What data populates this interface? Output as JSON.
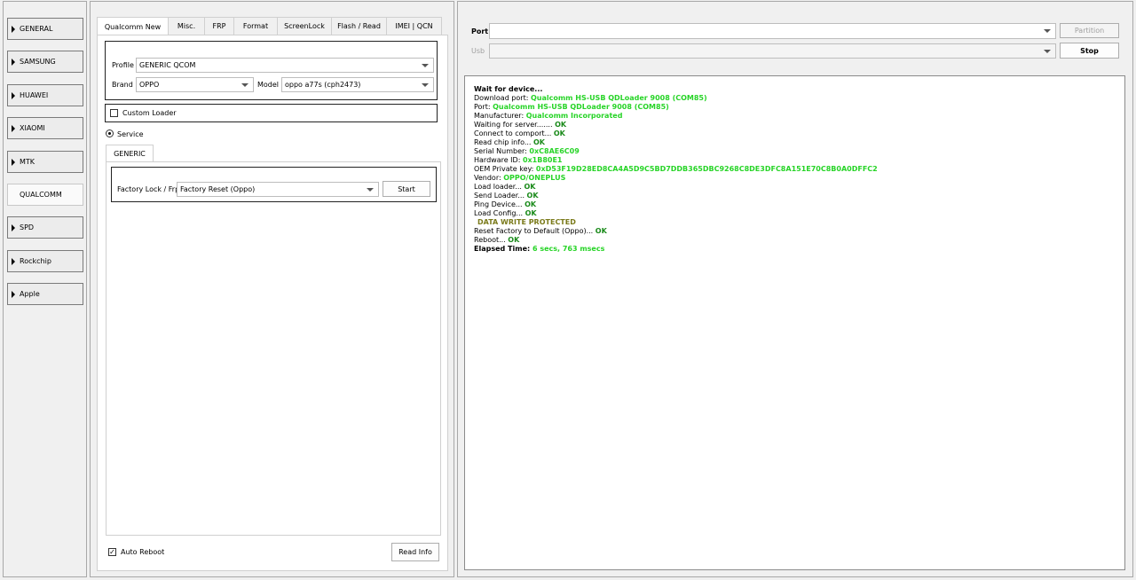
{
  "nav": {
    "items": [
      {
        "label": "GENERAL",
        "arrow": true
      },
      {
        "label": "SAMSUNG",
        "arrow": true
      },
      {
        "label": "HUAWEI",
        "arrow": true
      },
      {
        "label": "XIAOMI",
        "arrow": true
      },
      {
        "label": "MTK",
        "arrow": true
      },
      {
        "label": "QUALCOMM",
        "arrow": false,
        "active": true
      },
      {
        "label": "SPD",
        "arrow": true
      },
      {
        "label": "Rockchip",
        "arrow": true
      },
      {
        "label": "Apple",
        "arrow": true
      }
    ]
  },
  "tabs": [
    "Qualcomm New",
    "Misc.",
    "FRP",
    "Format",
    "ScreenLock",
    "Flash / Read",
    "IMEI | QCN"
  ],
  "form": {
    "profile_label": "Profile",
    "profile_value": "GENERIC QCOM",
    "brand_label": "Brand",
    "brand_value": "OPPO",
    "model_label": "Model",
    "model_value": "oppo a77s (cph2473)",
    "custom_loader_label": "Custom Loader",
    "service_label": "Service",
    "subtab_label": "GENERIC",
    "factory_label": "Factory Lock / Frp",
    "factory_value": "Factory Reset (Oppo)",
    "start_label": "Start",
    "auto_reboot_label": "Auto Reboot",
    "read_info_label": "Read Info"
  },
  "port": {
    "port_label": "Port",
    "usb_label": "Usb",
    "partition_label": "Partition",
    "stop_label": "Stop"
  },
  "log": {
    "wait": "Wait for device...",
    "download_port_label": "Download port: ",
    "download_port_value": "Qualcomm HS-USB QDLoader 9008 (COM85)",
    "port_label": "Port: ",
    "port_value": "Qualcomm HS-USB QDLoader 9008 (COM85)",
    "manufacturer_label": "Manufacturer: ",
    "manufacturer_value": "Qualcomm Incorporated",
    "waiting_server": "Waiting for server....... ",
    "connect_comport": "Connect to comport... ",
    "read_chip": "Read chip info... ",
    "serial_label": "Serial Number: ",
    "serial_value": "0xC8AE6C09",
    "hwid_label": "Hardware ID: ",
    "hwid_value": "0x1B80E1",
    "oem_label": "OEM Private key: ",
    "oem_value": "0xD53F19D28ED8CA4A5D9C5BD7DDB365DBC9268C8DE3DFC8A151E70C8B0A0DFFC2",
    "vendor_label": "Vendor: ",
    "vendor_value": "OPPO/ONEPLUS",
    "load_loader": "Load loader... ",
    "send_loader": "Send Loader... ",
    "ping_device": "Ping Device... ",
    "load_config": "Load Config... ",
    "data_write": "DATA WRITE PROTECTED",
    "reset_factory": "Reset Factory to Default (Oppo)... ",
    "reboot": "Reboot... ",
    "elapsed_label": "Elapsed Time: ",
    "elapsed_value": "6 secs, 763 msecs",
    "ok": "OK"
  }
}
